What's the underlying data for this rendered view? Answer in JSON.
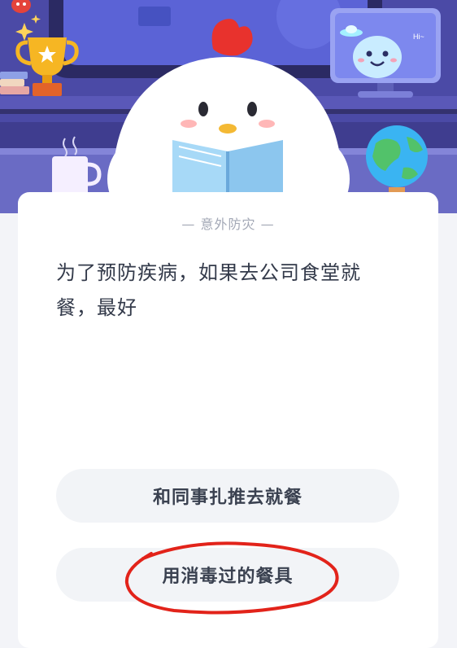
{
  "quiz": {
    "category": "意外防灾",
    "question": "为了预防疾病，如果去公司食堂就餐，最好",
    "options": [
      {
        "label": "和同事扎推去就餐"
      },
      {
        "label": "用消毒过的餐具"
      }
    ],
    "circled_option_index": 1
  },
  "scene": {
    "monitor_text": "Hi~"
  },
  "colors": {
    "scene_background": "#4b4aa6",
    "card_background": "#ffffff",
    "option_background": "#f2f4f7",
    "annotation_red": "#e2231a",
    "chick_comb": "#e8322d"
  }
}
